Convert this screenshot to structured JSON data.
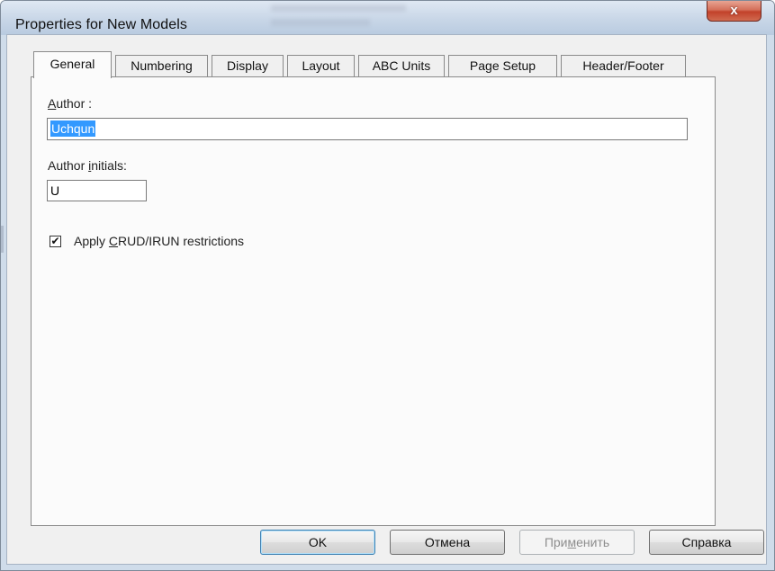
{
  "window": {
    "title": "Properties for New Models",
    "close_symbol": "x"
  },
  "tabs": [
    {
      "label": "General",
      "active": true
    },
    {
      "label": "Numbering",
      "active": false
    },
    {
      "label": "Display",
      "active": false
    },
    {
      "label": "Layout",
      "active": false
    },
    {
      "label": "ABC Units",
      "active": false
    },
    {
      "label": "Page Setup",
      "active": false
    },
    {
      "label": "Header/Footer",
      "active": false
    }
  ],
  "general": {
    "author_label_mnemonic": "A",
    "author_label_rest": "uthor :",
    "author_value": "Uchqun",
    "initials_label_pre": "Author ",
    "initials_label_mnemonic": "i",
    "initials_label_post": "nitials:",
    "initials_value": "U",
    "crud_checked": true,
    "crud_check_mark": "✔",
    "crud_label_pre": "Apply ",
    "crud_label_mnemonic": "C",
    "crud_label_post": "RUD/IRUN restrictions"
  },
  "buttons": {
    "ok": "OK",
    "cancel": "Отмена",
    "apply_pre": "При",
    "apply_mnemonic": "м",
    "apply_post": "енить",
    "help": "Справка"
  }
}
